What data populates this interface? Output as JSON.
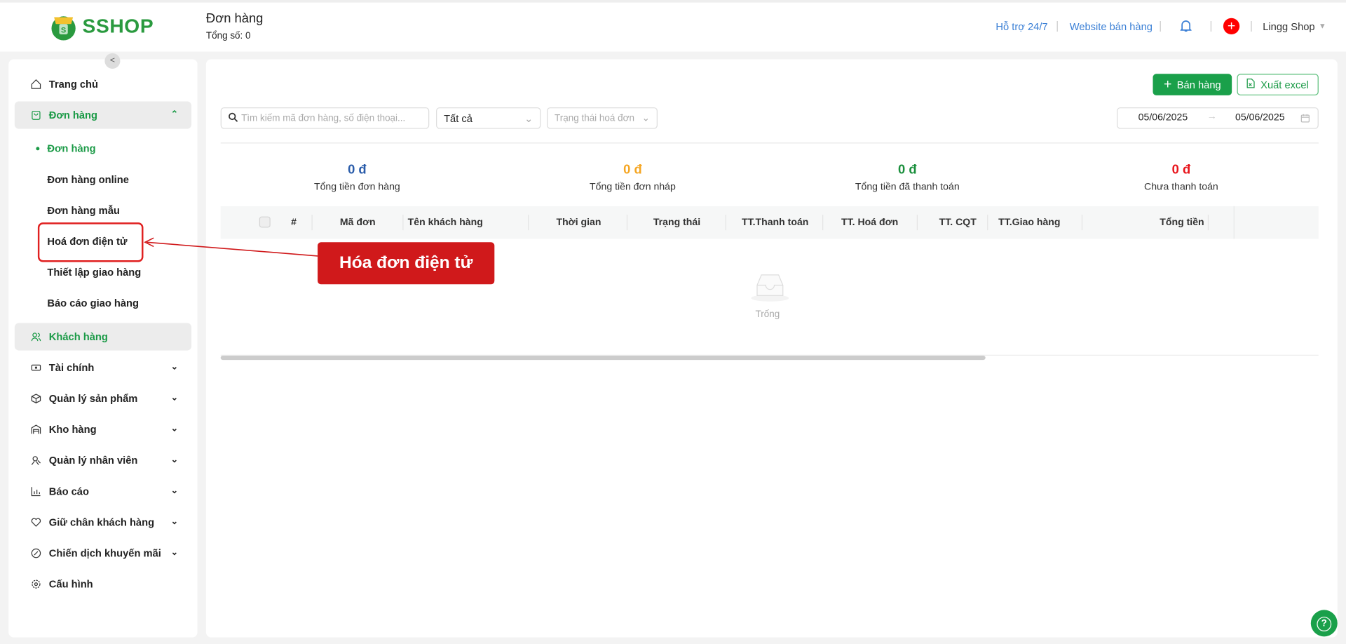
{
  "header": {
    "logo": "SSHOP",
    "title": "Đơn hàng",
    "subtitle": "Tổng số: 0",
    "support": "Hỗ trợ 24/7",
    "website": "Website bán hàng",
    "user": "Lingg Shop"
  },
  "sidebar": {
    "items": [
      {
        "label": "Trang chủ",
        "icon": "home-icon"
      },
      {
        "label": "Đơn hàng",
        "icon": "bag-icon"
      },
      {
        "label": "Khách hàng",
        "icon": "users-icon"
      },
      {
        "label": "Tài chính",
        "icon": "money-icon"
      },
      {
        "label": "Quản lý sản phẩm",
        "icon": "box-icon"
      },
      {
        "label": "Kho hàng",
        "icon": "warehouse-icon"
      },
      {
        "label": "Quản lý nhân viên",
        "icon": "staff-icon"
      },
      {
        "label": "Báo cáo",
        "icon": "chart-icon"
      },
      {
        "label": "Giữ chân khách hàng",
        "icon": "heart-icon"
      },
      {
        "label": "Chiến dịch khuyến mãi",
        "icon": "discount-icon"
      },
      {
        "label": "Cấu hình",
        "icon": "gear-icon"
      }
    ],
    "sub_items": [
      "Đơn hàng",
      "Đơn hàng online",
      "Đơn hàng mẫu",
      "Hoá đơn điện tử",
      "Thiết lập giao hàng",
      "Báo cáo giao hàng"
    ]
  },
  "annotation": {
    "callout": "Hóa đơn điện tử",
    "color": "#d0191b"
  },
  "toolbar": {
    "sell": "Bán hàng",
    "export": "Xuất excel"
  },
  "filters": {
    "search_placeholder": "Tìm kiếm mã đơn hàng, số điện thoại...",
    "status": "Tất cả",
    "invoice_status_placeholder": "Trạng thái hoá đơn",
    "date_from": "05/06/2025",
    "date_to": "05/06/2025"
  },
  "stats": [
    {
      "value": "0 đ",
      "label": "Tổng tiền đơn hàng",
      "color": "#2a5caa"
    },
    {
      "value": "0 đ",
      "label": "Tổng tiền đơn nháp",
      "color": "#f5a623"
    },
    {
      "value": "0 đ",
      "label": "Tổng tiền đã thanh toán",
      "color": "#1a8f3c"
    },
    {
      "value": "0 đ",
      "label": "Chưa thanh toán",
      "color": "#e8141b"
    }
  ],
  "table": {
    "columns": [
      "#",
      "Mã đơn",
      "Tên khách hàng",
      "Thời gian",
      "Trạng thái",
      "TT.Thanh toán",
      "TT. Hoá đơn",
      "TT. CQT",
      "TT.Giao hàng",
      "Tổng tiền"
    ],
    "empty": "Trống"
  }
}
